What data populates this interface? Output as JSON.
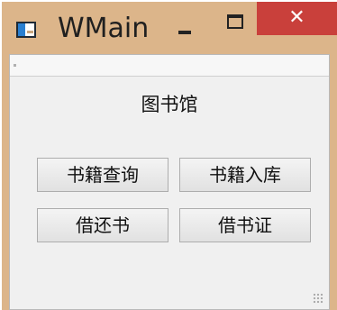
{
  "window": {
    "title": "WMain",
    "close_glyph": "✕",
    "frame_color": "#dcb58a",
    "close_color": "#c9403b"
  },
  "icons": {
    "app": "application-window-icon",
    "minimize": "minimize-icon",
    "maximize": "maximize-icon",
    "close": "close-icon"
  },
  "main": {
    "heading": "图书馆",
    "buttons": [
      {
        "label": "书籍查询"
      },
      {
        "label": "书籍入库"
      },
      {
        "label": "借还书"
      },
      {
        "label": "借书证"
      }
    ]
  }
}
